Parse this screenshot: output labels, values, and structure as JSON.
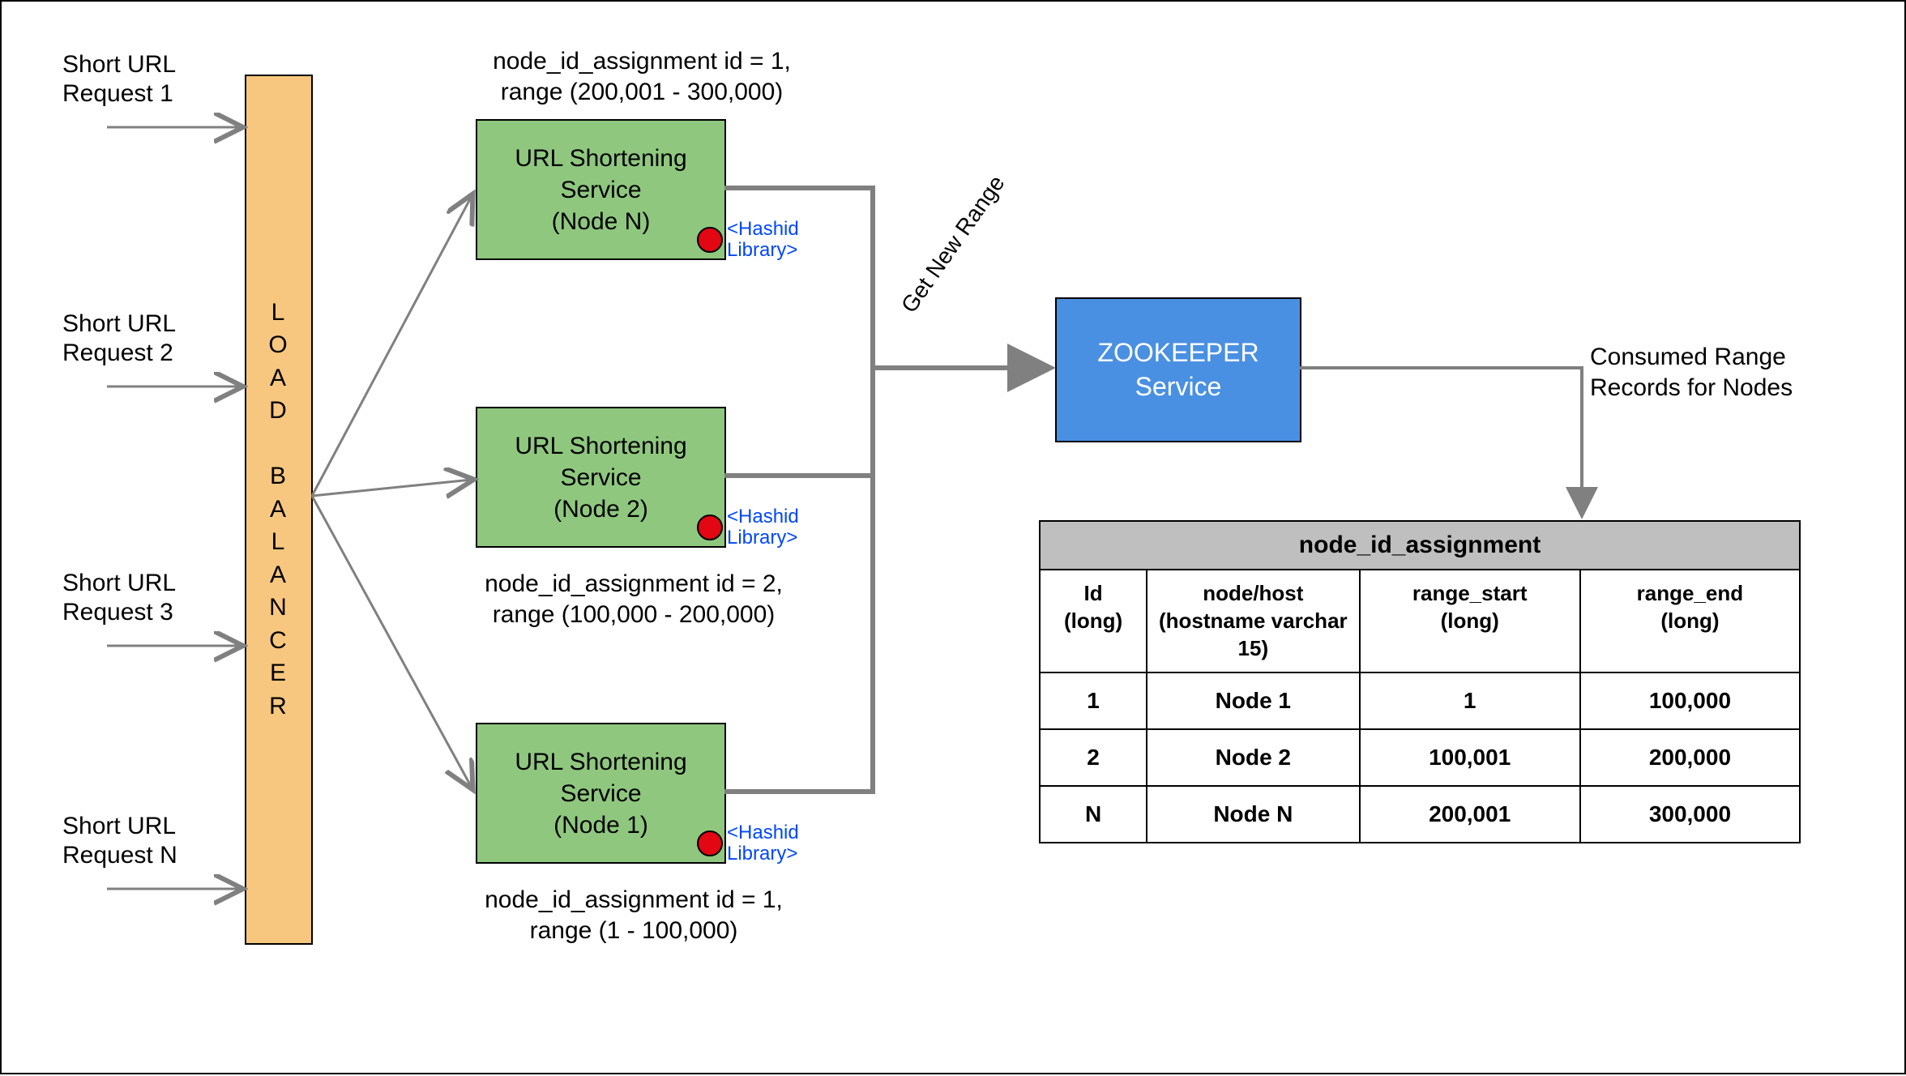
{
  "requests": [
    {
      "line1": "Short URL",
      "line2": "Request 1"
    },
    {
      "line1": "Short URL",
      "line2": "Request 2"
    },
    {
      "line1": "Short URL",
      "line2": "Request 3"
    },
    {
      "line1": "Short URL",
      "line2": "Request N"
    }
  ],
  "load_balancer": {
    "label": "L O A D   B A L A N C E R"
  },
  "services": [
    {
      "title_line1": "URL Shortening",
      "title_line2": "Service",
      "title_line3": "(Node N)",
      "hashid": "<Hashid Library>",
      "caption_line1": "node_id_assignment id = 1,",
      "caption_line2": "range (200,001 - 300,000)"
    },
    {
      "title_line1": "URL Shortening",
      "title_line2": "Service",
      "title_line3": "(Node 2)",
      "hashid": "<Hashid Library>",
      "caption_line1": "node_id_assignment id = 2,",
      "caption_line2": "range (100,000 - 200,000)"
    },
    {
      "title_line1": "URL Shortening",
      "title_line2": "Service",
      "title_line3": "(Node 1)",
      "hashid": "<Hashid Library>",
      "caption_line1": "node_id_assignment id = 1,",
      "caption_line2": "range (1 - 100,000)"
    }
  ],
  "edge_label_get_new_range": "Get New Range",
  "zookeeper": {
    "line1": "ZOOKEEPER",
    "line2": "Service"
  },
  "consumed_label": {
    "line1": "Consumed Range",
    "line2": "Records for Nodes"
  },
  "table": {
    "title": "node_id_assignment",
    "columns": [
      {
        "name": "Id",
        "type": "(long)"
      },
      {
        "name": "node/host",
        "type": "(hostname varchar 15)"
      },
      {
        "name": "range_start",
        "type": "(long)"
      },
      {
        "name": "range_end",
        "type": "(long)"
      }
    ],
    "rows": [
      {
        "id": "1",
        "host": "Node 1",
        "start": "1",
        "end": "100,000"
      },
      {
        "id": "2",
        "host": "Node 2",
        "start": "100,001",
        "end": "200,000"
      },
      {
        "id": "N",
        "host": "Node N",
        "start": "200,001",
        "end": "300,000"
      }
    ]
  }
}
